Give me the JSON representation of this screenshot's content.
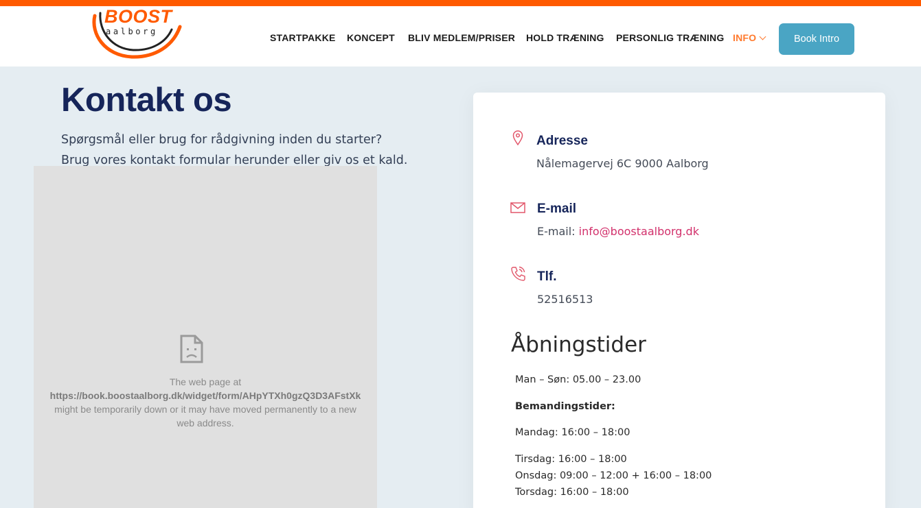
{
  "header": {
    "logo_word": "BOOST",
    "logo_sub": "aalborg",
    "nav": [
      {
        "label": "STARTPAKKE"
      },
      {
        "label": "KONCEPT"
      },
      {
        "label": "BLIV MEDLEM/PRISER"
      },
      {
        "label": "HOLD TRÆNING"
      },
      {
        "label": "PERSONLIG TRÆNING"
      },
      {
        "label": "INFO"
      }
    ],
    "cta_label": "Book Intro",
    "accent_color": "#ff5a00",
    "cta_color": "#4aa5c4"
  },
  "main": {
    "title": "Kontakt os",
    "intro_line1": "Spørgsmål eller brug for rådgivning inden du starter?",
    "intro_line2": "Brug vores kontakt formular herunder eller giv os et kald."
  },
  "iframe_error": {
    "icon": "sad-page-icon",
    "line1": "The web page at",
    "url": "https://book.boostaalborg.dk/widget/form/AHpYTXh0gzQ3D3AFstXk",
    "line3": "might be temporarily down or it may have moved permanently to a new",
    "line4": "web address."
  },
  "contact": {
    "address_title": "Adresse",
    "address_value": "Nålemagervej 6C 9000 Aalborg",
    "email_title": "E-mail",
    "email_prefix": "E-mail:",
    "email_value": "info@boostaalborg.dk",
    "phone_title": "Tlf.",
    "phone_value": "52516513",
    "icon_color": "#e2566a"
  },
  "hours": {
    "title": "Åbningstider",
    "general": "Man – Søn: 05.00 – 23.00",
    "staffed_title": "Bemandingstider:",
    "monday": "Mandag: 16:00 – 18:00",
    "tuesday": "Tirsdag: 16:00 – 18:00",
    "wednesday": "Onsdag: 09:00 – 12:00 + 16:00 – 18:00",
    "thursday": "Torsdag: 16:00 – 18:00"
  }
}
